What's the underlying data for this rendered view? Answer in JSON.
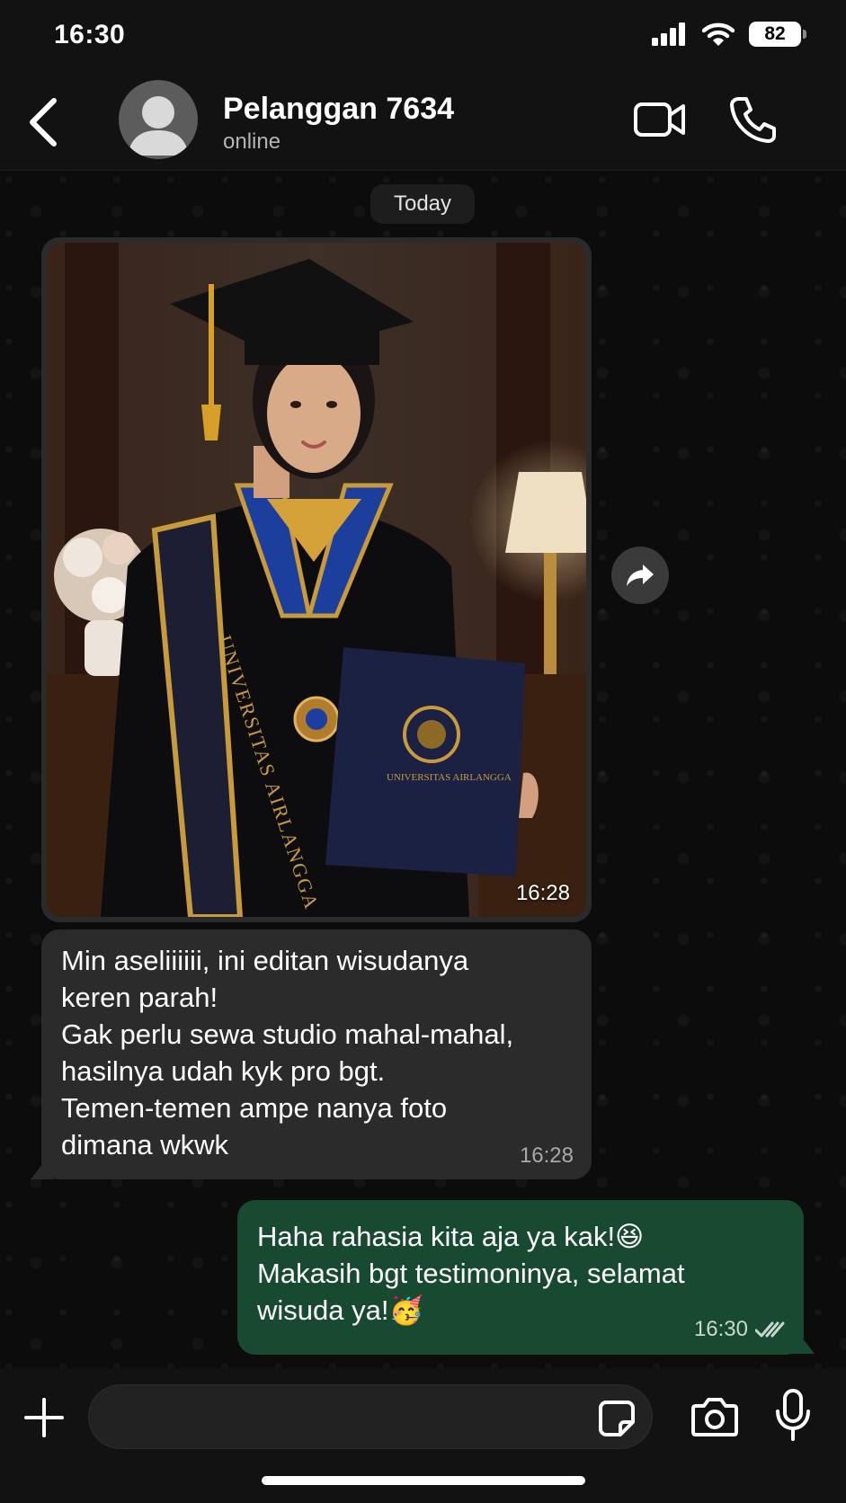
{
  "status_bar": {
    "time": "16:30",
    "battery": "82",
    "icons": [
      "signal-icon",
      "wifi-icon",
      "battery-icon"
    ]
  },
  "header": {
    "contact_name": "Pelanggan 7634",
    "contact_status": "online",
    "icons": [
      "back-chevron-icon",
      "avatar-icon",
      "video-camera-icon",
      "phone-icon"
    ]
  },
  "chat": {
    "date_label": "Today",
    "photo_message": {
      "time": "16:28",
      "sash_text": "UNIVERSITAS AIRLANGGA",
      "folder_text": "UNIVERSITAS AIRLANGGA"
    },
    "incoming_message": {
      "text": "Min aseliiiiii, ini editan wisudanya\nkeren parah!\nGak perlu sewa studio mahal-mahal,\nhasilnya udah kyk pro bgt.\nTemen-temen ampe nanya foto\ndimana wkwk",
      "time": "16:28"
    },
    "outgoing_message": {
      "text": "Haha rahasia kita aja ya kak!😆\nMakasih bgt testimoninya, selamat\nwisuda ya!🥳",
      "time": "16:30",
      "status_icon": "double-check-icon"
    }
  },
  "composer": {
    "input_value": "",
    "icons": [
      "plus-icon",
      "sticker-icon",
      "camera-icon",
      "microphone-icon"
    ]
  },
  "colors": {
    "outgoing_bubble": "#174a31",
    "incoming_bubble": "#2b2b2b",
    "background": "#0c0c0c"
  }
}
